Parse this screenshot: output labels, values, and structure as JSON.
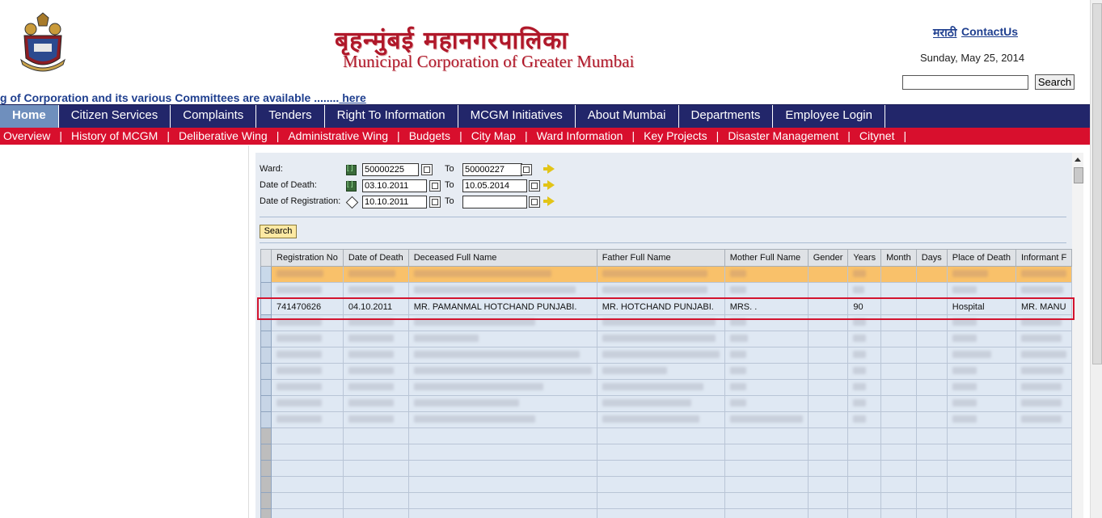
{
  "header": {
    "title_hi": "बृहन्मुंबई महानगरपालिका",
    "title_en": "Municipal Corporation of Greater Mumbai",
    "lang_link": "मराठी",
    "contact_link": "ContactUs",
    "date": "Sunday, May 25, 2014",
    "search_placeholder": "",
    "search_button": "Search",
    "marquee_text": "g of Corporation and its various Committees are available ........",
    "marquee_link": " here"
  },
  "nav": {
    "items": [
      "Home",
      "Citizen Services",
      "Complaints",
      "Tenders",
      "Right To Information",
      "MCGM Initiatives",
      "About Mumbai",
      "Departments",
      "Employee Login"
    ],
    "active": "Home"
  },
  "subnav": {
    "items": [
      "Overview",
      "History of MCGM",
      "Deliberative Wing",
      "Administrative Wing",
      "Budgets",
      "City Map",
      "Ward Information",
      "Key Projects",
      "Disaster Management",
      "Citynet"
    ]
  },
  "filters": {
    "ward": {
      "label": "Ward:",
      "from": "50000225",
      "to_label": "To",
      "to": "50000227"
    },
    "death": {
      "label": "Date of Death:",
      "from": "03.10.2011",
      "to_label": "To",
      "to": "10.05.2014"
    },
    "registration": {
      "label": "Date of Registration:",
      "from": "10.10.2011",
      "to_label": "To",
      "to": ""
    },
    "search_button": "Search"
  },
  "table": {
    "columns": [
      "Registration No",
      "Date of Death",
      "Deceased Full Name",
      "Father Full Name",
      "Mother Full Name",
      "Gender",
      "Years",
      "Month",
      "Days",
      "Place of Death",
      "Informant F"
    ],
    "focused_row": {
      "registration_no": "741470626",
      "date_of_death": "04.10.2011",
      "deceased_name": "MR. PAMANMAL HOTCHAND PUNJABI.",
      "father_name": "MR. HOTCHAND PUNJABI.",
      "mother_name": "MRS. .",
      "gender": "",
      "years": "90",
      "month": "",
      "days": "",
      "place_of_death": "Hospital",
      "informant": "MR. MANU"
    }
  },
  "colors": {
    "nav_bg": "#22266a",
    "nav_active": "#6f8fbd",
    "subnav_bg": "#d80f2d",
    "title_red": "#b0182a",
    "highlight_border": "#d3142f"
  }
}
